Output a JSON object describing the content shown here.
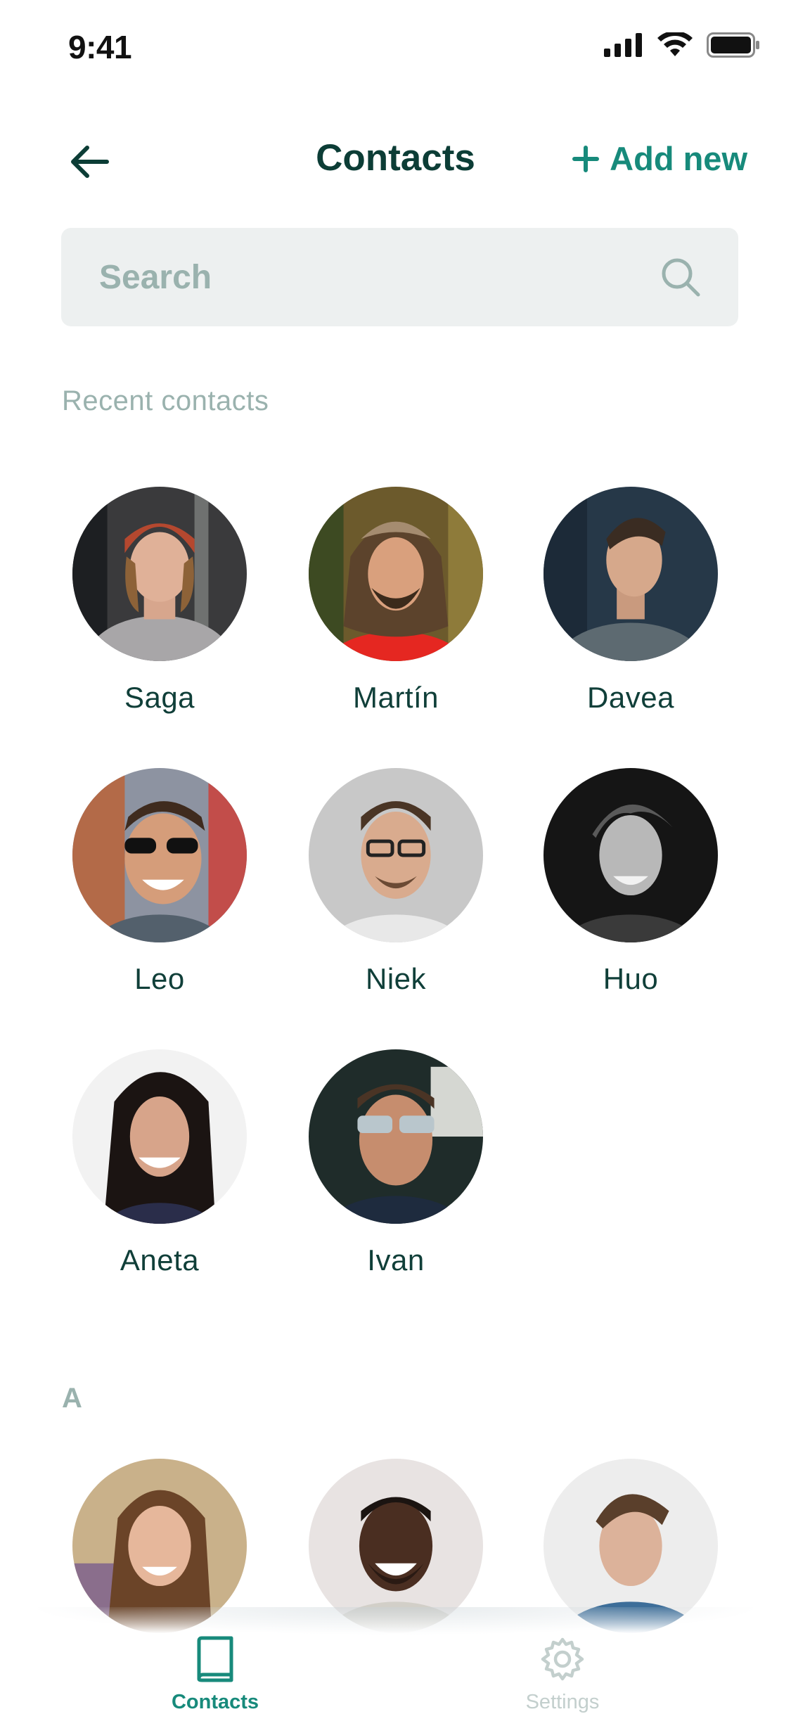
{
  "status": {
    "time": "9:41"
  },
  "nav": {
    "title": "Contacts",
    "add_label": "Add new"
  },
  "search": {
    "placeholder": "Search"
  },
  "recent": {
    "label": "Recent contacts",
    "contacts": [
      {
        "name": "Saga"
      },
      {
        "name": "Martín"
      },
      {
        "name": "Davea"
      },
      {
        "name": "Leo"
      },
      {
        "name": "Niek"
      },
      {
        "name": "Huo"
      },
      {
        "name": "Aneta"
      },
      {
        "name": "Ivan"
      }
    ]
  },
  "section_a": {
    "label": "A"
  },
  "tabs": [
    {
      "label": "Contacts",
      "icon": "book-icon",
      "active": true
    },
    {
      "label": "Settings",
      "icon": "gear-icon",
      "active": false
    }
  ],
  "colors": {
    "accent": "#178a7b",
    "title": "#0c3d36",
    "muted": "#9ab2ae",
    "search_bg": "#edf0f0"
  }
}
